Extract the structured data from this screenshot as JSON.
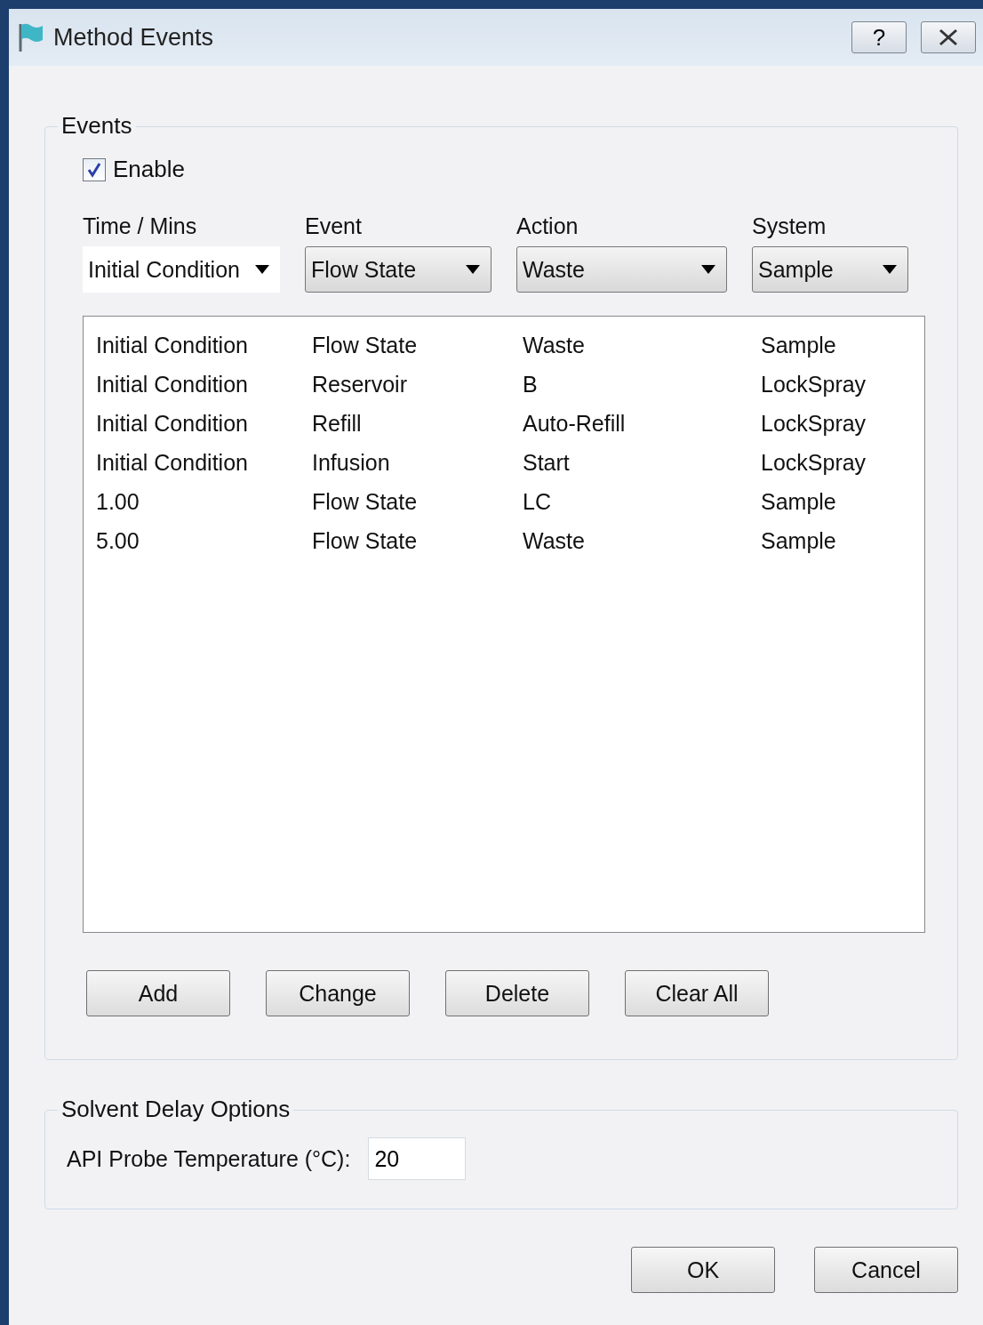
{
  "window": {
    "title": "Method Events",
    "help_button": "?"
  },
  "events": {
    "title": "Events",
    "enable": {
      "label": "Enable",
      "checked": true
    },
    "selectors": [
      {
        "label": "Time / Mins",
        "value": "Initial Condition",
        "kind": "edit"
      },
      {
        "label": "Event",
        "value": "Flow State",
        "kind": "button"
      },
      {
        "label": "Action",
        "value": "Waste",
        "kind": "button"
      },
      {
        "label": "System",
        "value": "Sample",
        "kind": "button"
      }
    ],
    "rows": [
      [
        "Initial Condition",
        "Flow State",
        "Waste",
        "Sample"
      ],
      [
        "Initial Condition",
        "Reservoir",
        "B",
        "LockSpray"
      ],
      [
        "Initial Condition",
        "Refill",
        "Auto-Refill",
        "LockSpray"
      ],
      [
        "Initial Condition",
        "Infusion",
        "Start",
        "LockSpray"
      ],
      [
        "1.00",
        "Flow State",
        "LC",
        "Sample"
      ],
      [
        "5.00",
        "Flow State",
        "Waste",
        "Sample"
      ]
    ],
    "buttons": [
      "Add",
      "Change",
      "Delete",
      "Clear All"
    ]
  },
  "solvent_delay": {
    "title": "Solvent Delay Options",
    "label": "API Probe Temperature (°C):",
    "value": "20"
  },
  "buttons": [
    "OK",
    "Cancel"
  ]
}
